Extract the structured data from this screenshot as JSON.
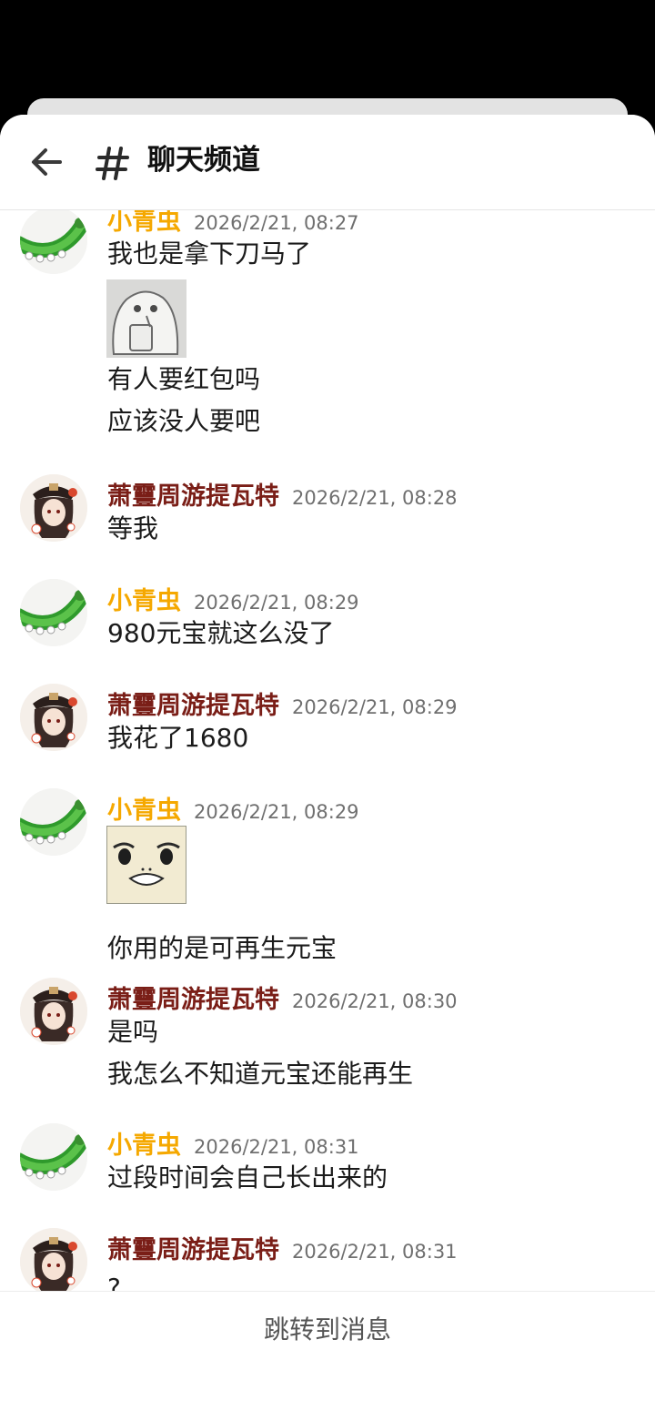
{
  "header": {
    "title": "聊天频道",
    "back_icon": "arrow-left-icon",
    "channel_icon": "hash-icon"
  },
  "users": {
    "a": {
      "name": "小青虫",
      "color": "#f5a800",
      "avatar": "green-caterpillar-avatar"
    },
    "b": {
      "name": "萧靊周游提瓦特",
      "color": "#7a1e17",
      "avatar": "anime-character-avatar"
    }
  },
  "messages": [
    {
      "user": "小青虫",
      "time": "2026/2/21, 08:27",
      "lines": [
        "我也是拿下刀马了",
        "有人要红包吗",
        "应该没人要吧"
      ],
      "sticker": "ghost-drinking-sticker"
    },
    {
      "user": "萧靊周游提瓦特",
      "time": "2026/2/21, 08:28",
      "lines": [
        "等我"
      ]
    },
    {
      "user": "小青虫",
      "time": "2026/2/21, 08:29",
      "lines": [
        "980元宝就这么没了"
      ]
    },
    {
      "user": "萧靊周游提瓦特",
      "time": "2026/2/21, 08:29",
      "lines": [
        "我花了1680"
      ]
    },
    {
      "user": "小青虫",
      "time": "2026/2/21, 08:29",
      "lines": [
        "你用的是可再生元宝"
      ],
      "sticker": "funny-face-sticker"
    },
    {
      "user": "萧靊周游提瓦特",
      "time": "2026/2/21, 08:30",
      "lines": [
        "是吗",
        "我怎么不知道元宝还能再生"
      ]
    },
    {
      "user": "小青虫",
      "time": "2026/2/21, 08:31",
      "lines": [
        "过段时间会自己长出来的"
      ]
    },
    {
      "user": "萧靊周游提瓦特",
      "time": "2026/2/21, 08:31",
      "lines": [
        "?"
      ]
    }
  ],
  "footer": {
    "jump_label": "跳转到消息"
  }
}
